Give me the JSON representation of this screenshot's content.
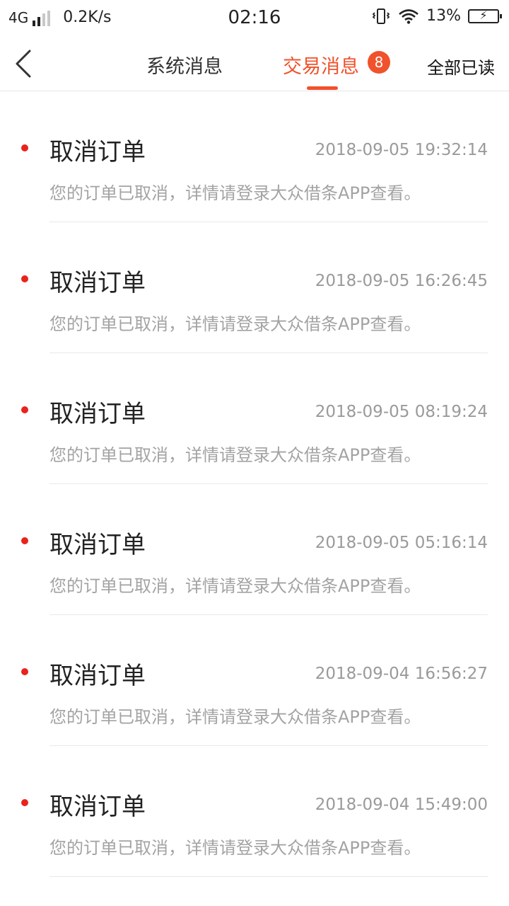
{
  "status_bar": {
    "network": "4G",
    "speed": "0.2K/s",
    "time": "02:16",
    "battery": "13%"
  },
  "nav": {
    "tabs": [
      {
        "label": "系统消息"
      },
      {
        "label": "交易消息",
        "badge": "8"
      }
    ],
    "mark_all_read": "全部已读"
  },
  "colors": {
    "accent": "#f0522c",
    "unread_dot": "#e8231c"
  },
  "messages": [
    {
      "title": "取消订单",
      "time": "2018-09-05 19:32:14",
      "desc": "您的订单已取消，详情请登录大众借条APP查看。"
    },
    {
      "title": "取消订单",
      "time": "2018-09-05 16:26:45",
      "desc": "您的订单已取消，详情请登录大众借条APP查看。"
    },
    {
      "title": "取消订单",
      "time": "2018-09-05 08:19:24",
      "desc": "您的订单已取消，详情请登录大众借条APP查看。"
    },
    {
      "title": "取消订单",
      "time": "2018-09-05 05:16:14",
      "desc": "您的订单已取消，详情请登录大众借条APP查看。"
    },
    {
      "title": "取消订单",
      "time": "2018-09-04 16:56:27",
      "desc": "您的订单已取消，详情请登录大众借条APP查看。"
    },
    {
      "title": "取消订单",
      "time": "2018-09-04 15:49:00",
      "desc": "您的订单已取消，详情请登录大众借条APP查看。"
    }
  ]
}
